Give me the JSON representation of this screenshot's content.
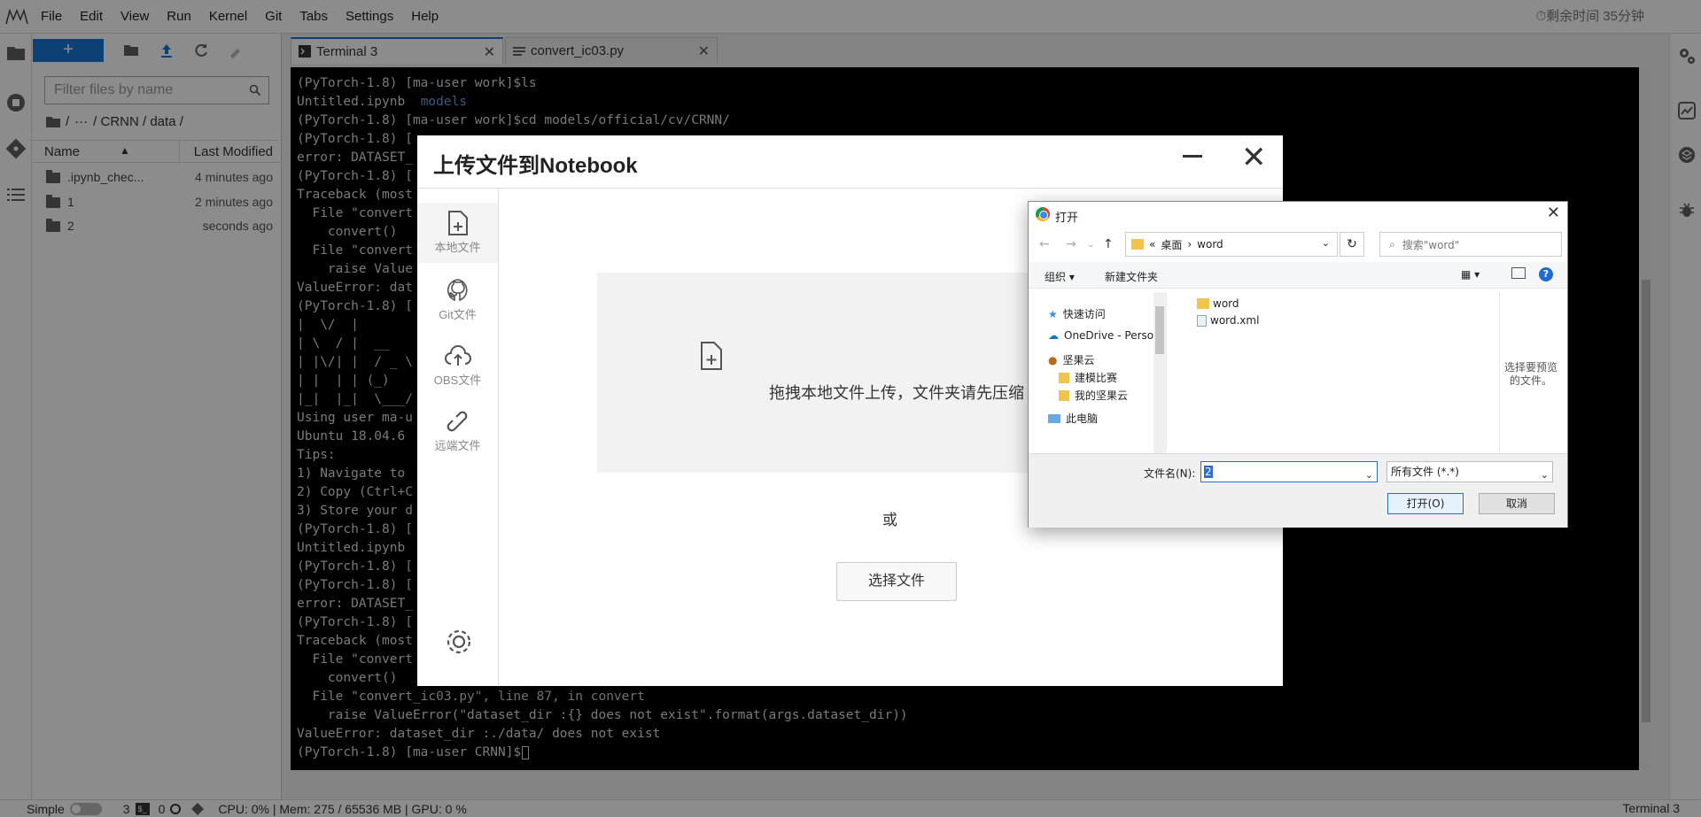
{
  "menubar": {
    "items": [
      "File",
      "Edit",
      "View",
      "Run",
      "Kernel",
      "Git",
      "Tabs",
      "Settings",
      "Help"
    ],
    "timer": "剩余时间 35分钟"
  },
  "filebrowser": {
    "search_placeholder": "Filter files by name",
    "breadcrumb": [
      "/",
      "···",
      "/ CRNN / data /"
    ],
    "header_name": "Name",
    "header_modified": "Last Modified",
    "files": [
      {
        "name": ".ipynb_chec...",
        "modified": "4 minutes ago"
      },
      {
        "name": "1",
        "modified": "2 minutes ago"
      },
      {
        "name": "2",
        "modified": "seconds ago"
      }
    ]
  },
  "tabs": [
    {
      "label": "Terminal 3"
    },
    {
      "label": "convert_ic03.py"
    }
  ],
  "terminal": {
    "lines": [
      "(PyTorch-1.8) [ma-user work]$ls",
      "Untitled.ipynb  models",
      "(PyTorch-1.8) [ma-user work]$cd models/official/cv/CRNN/",
      "(PyTorch-1.8) [",
      "error: DATASET_",
      "(PyTorch-1.8) [",
      "Traceback (most",
      "  File \"convert",
      "    convert()",
      "  File \"convert",
      "    raise Value",
      "ValueError: dat",
      "(PyTorch-1.8) [",
      "|  \\/  |",
      "| \\  / |  __",
      "| |\\/| |  / _ \\",
      "| |  | | (_)",
      "|_|  |_|  \\___/",
      "Using user ma-u",
      "Ubuntu 18.04.6",
      "Tips:",
      "1) Navigate to",
      "2) Copy (Ctrl+C",
      "3) Store your d",
      "(PyTorch-1.8) [",
      "Untitled.ipynb",
      "(PyTorch-1.8) [",
      "(PyTorch-1.8) [",
      "error: DATASET_",
      "(PyTorch-1.8) [",
      "Traceback (most",
      "  File \"convert",
      "    convert()",
      "  File \"convert_ic03.py\", line 87, in convert",
      "    raise ValueError(\"dataset_dir :{} does not exist\".format(args.dataset_dir))",
      "ValueError: dataset_dir :./data/ does not exist",
      "(PyTorch-1.8) [ma-user CRNN]$"
    ]
  },
  "statusbar": {
    "mode": "Simple",
    "terminals": "3",
    "kernels": "0",
    "resources": "CPU: 0% | Mem: 275 / 65536 MB | GPU: 0 %",
    "active": "Terminal 3"
  },
  "upload": {
    "title": "上传文件到Notebook",
    "side": [
      "本地文件",
      "Git文件",
      "OBS文件",
      "远端文件"
    ],
    "drop_text": "拖拽本地文件上传，文件夹请先压缩",
    "or": "或",
    "choose": "选择文件"
  },
  "file_dialog": {
    "title": "打开",
    "path": [
      "«",
      "桌面",
      "›",
      "word"
    ],
    "search_placeholder": "搜索\"word\"",
    "organize": "组织 ▾",
    "new_folder": "新建文件夹",
    "tree": [
      "快速访问",
      "OneDrive - Perso",
      "坚果云",
      "建模比赛",
      "我的坚果云",
      "此电脑"
    ],
    "files": [
      "word",
      "word.xml"
    ],
    "preview": "选择要预览的文件。",
    "filename_label": "文件名(N):",
    "filename_value": "2",
    "filter": "所有文件 (*.*)",
    "open": "打开(O)",
    "cancel": "取消"
  }
}
